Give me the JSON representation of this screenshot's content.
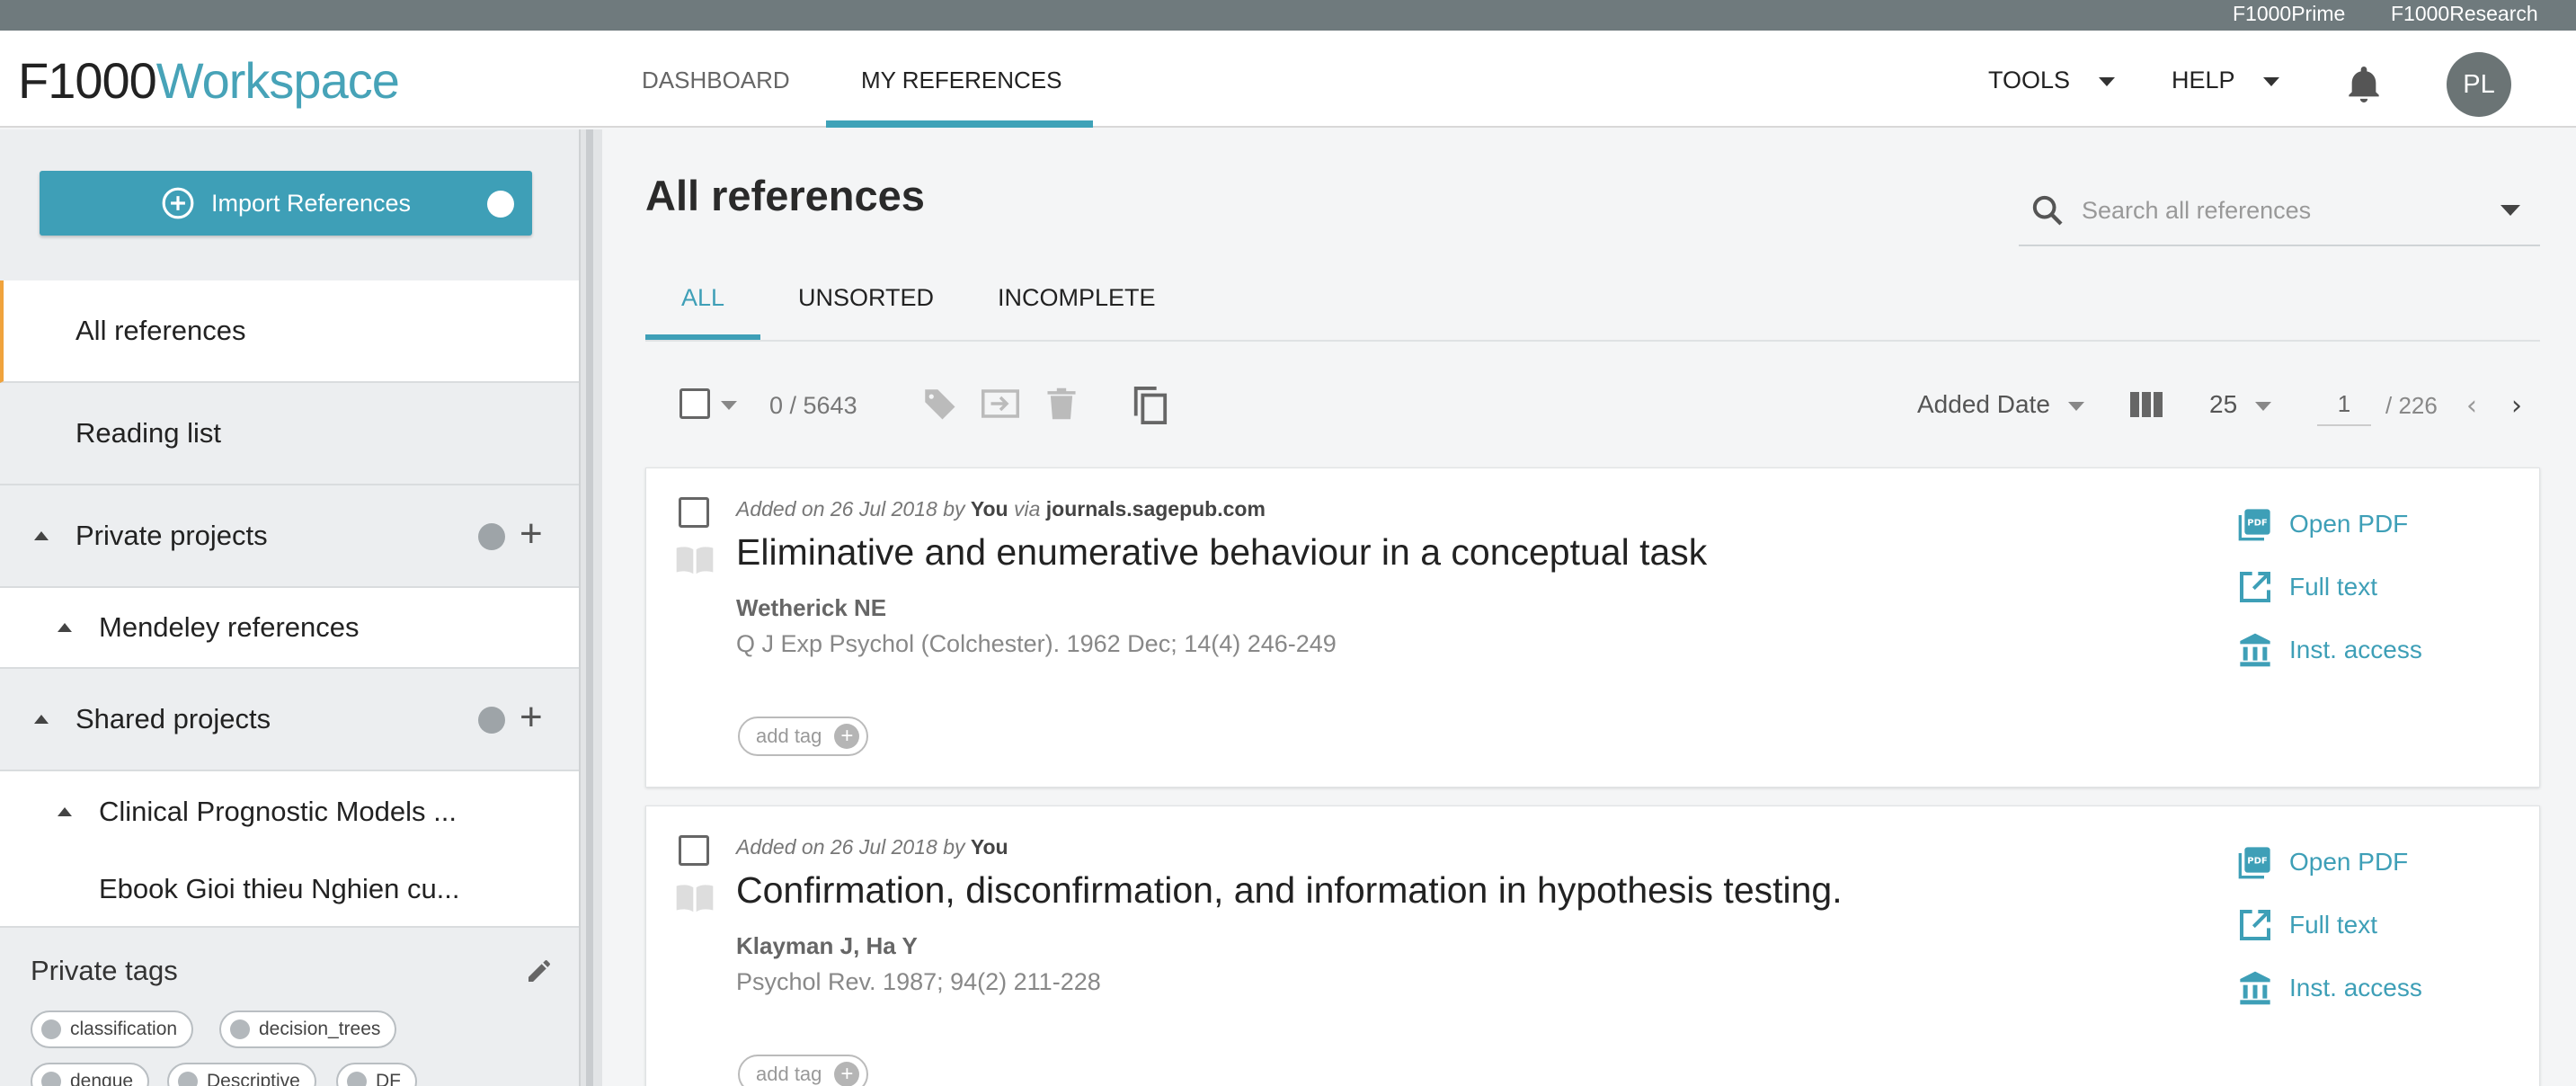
{
  "top_links": [
    "F1000Prime",
    "F1000Research"
  ],
  "header": {
    "logo_f1000": "F1000",
    "logo_workspace": "Workspace",
    "nav": [
      "DASHBOARD",
      "MY REFERENCES"
    ],
    "tools_label": "TOOLS",
    "help_label": "HELP",
    "avatar_initials": "PL"
  },
  "sidebar": {
    "import_label": "Import References",
    "all_references": "All references",
    "reading_list": "Reading list",
    "private_projects": "Private projects",
    "mendeley": "Mendeley references",
    "shared_projects": "Shared projects",
    "clinical": "Clinical Prognostic Models ...",
    "ebook": "Ebook Gioi thieu Nghien cu...",
    "private_tags": "Private tags",
    "tags": [
      "classification",
      "decision_trees",
      "dengue",
      "Descriptive",
      "DF"
    ]
  },
  "main": {
    "title": "All references",
    "search_placeholder": "Search all references",
    "tabs": [
      "ALL",
      "UNSORTED",
      "INCOMPLETE"
    ],
    "selection_count": "0 / 5643",
    "sort_label": "Added Date",
    "per_page": "25",
    "page_current": "1",
    "page_total": "/ 226"
  },
  "references": [
    {
      "added_prefix": "Added on 26 Jul 2018 by",
      "added_by": "You",
      "via": "via",
      "source": "journals.sagepub.com",
      "title": "Eliminative and enumerative behaviour in a conceptual task",
      "authors": "Wetherick NE",
      "journal": "Q J Exp Psychol (Colchester). 1962 Dec; 14(4) 246-249",
      "add_tag": "add tag"
    },
    {
      "added_prefix": "Added on 26 Jul 2018 by",
      "added_by": "You",
      "title": "Confirmation, disconfirmation, and information in hypothesis testing.",
      "authors": "Klayman J, Ha Y",
      "journal": "Psychol Rev. 1987; 94(2) 211-228",
      "add_tag": "add tag"
    }
  ],
  "actions": {
    "open_pdf": "Open PDF",
    "full_text": "Full text",
    "inst_access": "Inst. access"
  },
  "colors": {
    "accent": "#3e9fb7",
    "active_marker": "#f0a33c",
    "top_strip": "#6f7a7d"
  }
}
